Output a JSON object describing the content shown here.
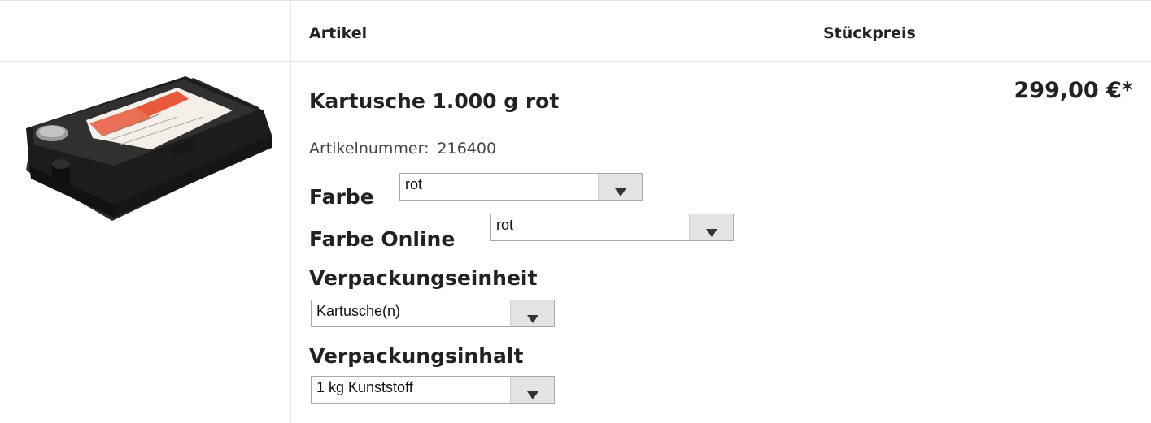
{
  "table": {
    "headers": {
      "artikel": "Artikel",
      "stueckpreis": "Stückpreis"
    }
  },
  "product": {
    "image_alt": "Primeprint Cast Kartusche",
    "title": "Kartusche 1.000 g rot",
    "artnr_label": "Artikelnummer:",
    "artnr_value": "216400",
    "price": "299,00 €*"
  },
  "options": {
    "farbe": {
      "label": "Farbe",
      "selected": "rot"
    },
    "farbe_online": {
      "label": "Farbe Online",
      "selected": "rot"
    },
    "verpackungseinheit": {
      "label": "Verpackungseinheit",
      "selected": "Kartusche(n)"
    },
    "verpackungsinhalt": {
      "label": "Verpackungsinhalt",
      "selected": "1 kg Kunststoff"
    }
  },
  "icons": {
    "dropdown": "chevron-down-icon"
  },
  "colors": {
    "grid": "#e6e6e6",
    "text": "#222222",
    "select_button": "#e3e3e3",
    "label_accent": "#e8583a"
  }
}
